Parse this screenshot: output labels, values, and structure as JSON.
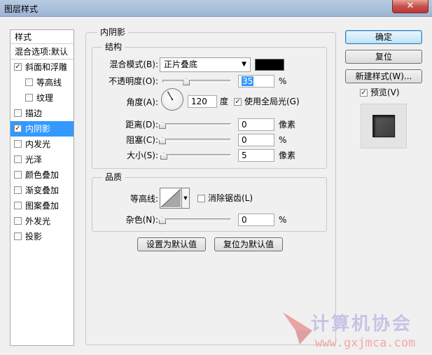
{
  "window": {
    "title": "图层样式",
    "close_label": "✕"
  },
  "styles_panel": {
    "header": "样式",
    "blend_options": "混合选项:默认",
    "items": [
      {
        "label": "斜面和浮雕",
        "checked": true,
        "selected": false,
        "indent": false
      },
      {
        "label": "等高线",
        "checked": false,
        "selected": false,
        "indent": true
      },
      {
        "label": "纹理",
        "checked": false,
        "selected": false,
        "indent": true
      },
      {
        "label": "描边",
        "checked": false,
        "selected": false,
        "indent": false
      },
      {
        "label": "内阴影",
        "checked": true,
        "selected": true,
        "indent": false
      },
      {
        "label": "内发光",
        "checked": false,
        "selected": false,
        "indent": false
      },
      {
        "label": "光泽",
        "checked": false,
        "selected": false,
        "indent": false
      },
      {
        "label": "颜色叠加",
        "checked": false,
        "selected": false,
        "indent": false
      },
      {
        "label": "渐变叠加",
        "checked": false,
        "selected": false,
        "indent": false
      },
      {
        "label": "图案叠加",
        "checked": false,
        "selected": false,
        "indent": false
      },
      {
        "label": "外发光",
        "checked": false,
        "selected": false,
        "indent": false
      },
      {
        "label": "投影",
        "checked": false,
        "selected": false,
        "indent": false
      }
    ]
  },
  "inner_shadow": {
    "title": "内阴影",
    "structure": {
      "title": "结构",
      "blend_mode_label": "混合模式(B):",
      "blend_mode_value": "正片叠底",
      "shadow_color": "#000000",
      "opacity_label": "不透明度(O):",
      "opacity_value": "35",
      "opacity_level": 35,
      "percent_unit": "%",
      "angle_label": "角度(A):",
      "angle_value": "120",
      "angle_unit": "度",
      "global_light_label": "使用全局光(G)",
      "global_light_checked": true,
      "distance_label": "距离(D):",
      "distance_value": "0",
      "distance_level": 0,
      "distance_unit": "像素",
      "choke_label": "阻塞(C):",
      "choke_value": "0",
      "choke_level": 0,
      "choke_unit": "%",
      "size_label": "大小(S):",
      "size_value": "5",
      "size_level": 2,
      "size_unit": "像素"
    },
    "quality": {
      "title": "品质",
      "contour_label": "等高线:",
      "antialias_label": "消除锯齿(L)",
      "antialias_checked": false,
      "noise_label": "杂色(N):",
      "noise_value": "0",
      "noise_level": 0,
      "noise_unit": "%"
    },
    "make_default": "设置为默认值",
    "reset_default": "复位为默认值"
  },
  "buttons": {
    "ok": "确定",
    "reset": "复位",
    "new_style": "新建样式(W)...",
    "preview_label": "预览(V)",
    "preview_checked": true
  },
  "watermark": {
    "text": "计算机协会",
    "url": "www.gxjmca.com"
  }
}
